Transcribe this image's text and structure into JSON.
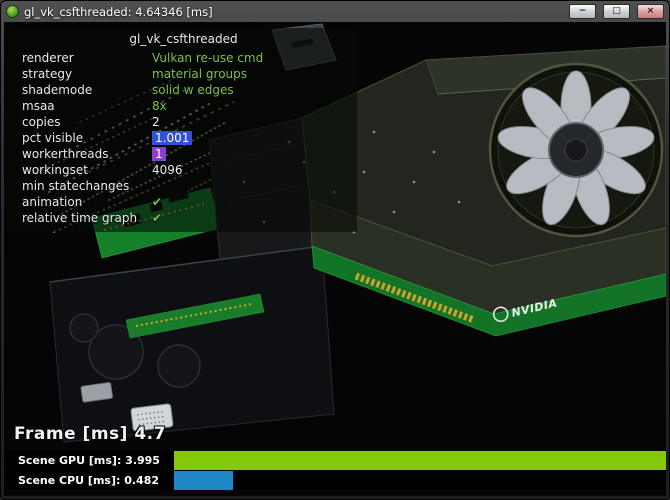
{
  "window": {
    "title": "gl_vk_csfthreaded: 4.64346 [ms]",
    "minimize_glyph": "−",
    "maximize_glyph": "□",
    "close_glyph": "×"
  },
  "panel": {
    "title": "gl_vk_csfthreaded",
    "rows": [
      {
        "label": "renderer",
        "value": "Vulkan re-use cmd"
      },
      {
        "label": "strategy",
        "value": "material groups"
      },
      {
        "label": "shademode",
        "value": "solid w edges"
      },
      {
        "label": "msaa",
        "value": "8x"
      },
      {
        "label": "copies",
        "value": "2"
      },
      {
        "label": "pct visible",
        "value": "1.001"
      },
      {
        "label": "workerthreads",
        "value": "1"
      },
      {
        "label": "workingset",
        "value": "4096"
      },
      {
        "label": "min statechanges",
        "value": ""
      },
      {
        "label": "animation",
        "value": "✔"
      },
      {
        "label": "relative time graph",
        "value": "✔"
      }
    ]
  },
  "hud": {
    "frame_text": "Frame [ms] 4.7",
    "bars": [
      {
        "label": "Scene GPU [ms]: 3.995",
        "color": "#84c80a",
        "fraction": 1.0
      },
      {
        "label": "Scene CPU [ms]: 0.482",
        "color": "#1f86c8",
        "fraction": 0.12
      }
    ]
  },
  "scene": {
    "nvidia_logo": "NVIDIA"
  },
  "colors": {
    "value_green": "#7cc24a",
    "select_blue": "#3350d8",
    "select_purple": "#8a3fd0",
    "gpu_bar": "#84c80a",
    "cpu_bar": "#1f86c8"
  }
}
